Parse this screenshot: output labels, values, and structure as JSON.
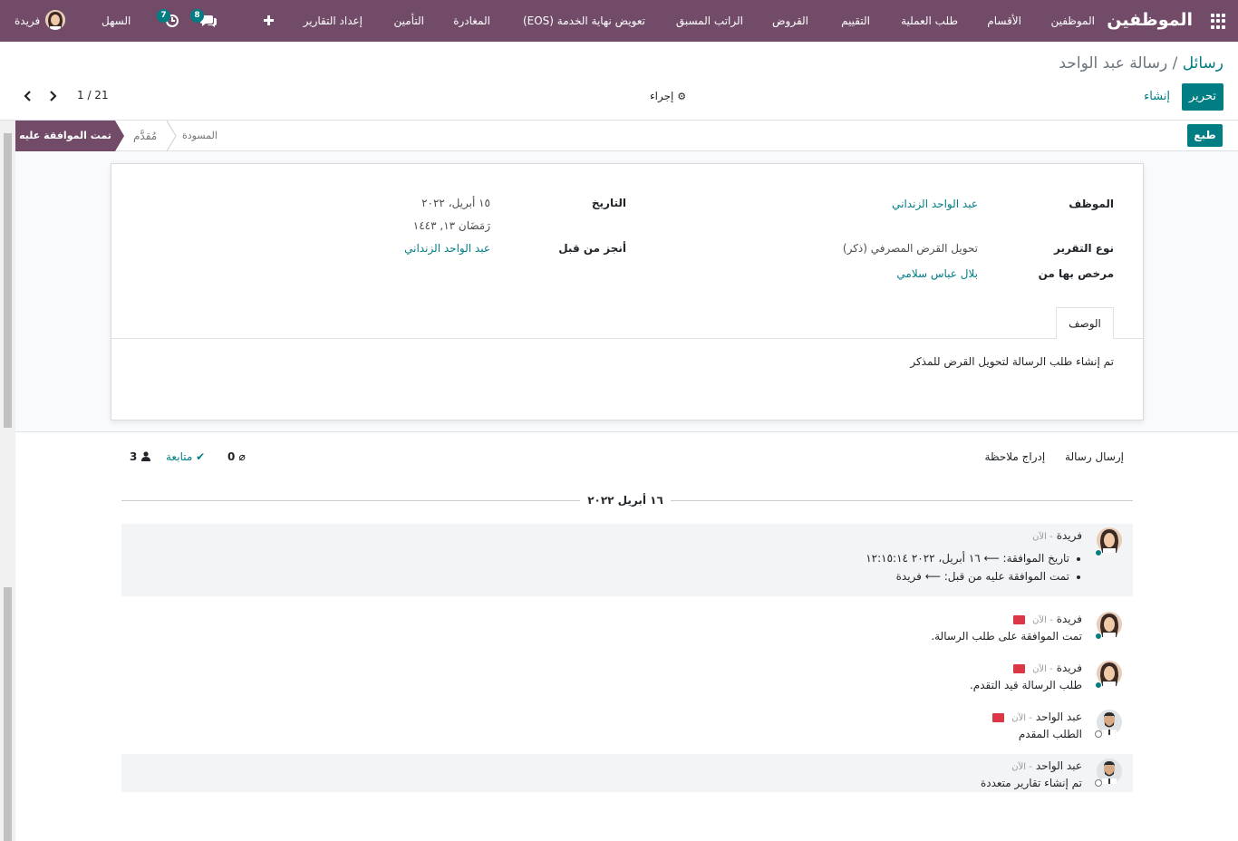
{
  "navbar": {
    "brand": "الموظفين",
    "menu": [
      "الموظفين",
      "الأقسام",
      "طلب العملية",
      "التقييم",
      "القروض",
      "الراتب المسبق",
      "تعويض نهاية الخدمة (EOS)",
      "المغادرة",
      "التأمين",
      "إعداد التقارير"
    ],
    "add_icon": "plus-icon",
    "messages_count": "8",
    "activities_count": "7",
    "company": "السهل",
    "user": "فريدة"
  },
  "control_panel": {
    "breadcrumb_parent": "رسائل",
    "breadcrumb_sep": " / ",
    "breadcrumb_current": "رسالة عبد الواحد",
    "edit_label": "تحرير",
    "create_label": "إنشاء",
    "action_label": "إجراء",
    "pager": "1 / 21"
  },
  "statusbar": {
    "print_label": "طبع",
    "stages": [
      "المسودة",
      "مُقدَّم",
      "تمت الموافقة عليه"
    ],
    "active_stage": "تمت الموافقة عليه"
  },
  "form": {
    "employee_label": "الموظف",
    "employee_value": "عبد الواحد الزنداني",
    "report_type_label": "نوع التقرير",
    "report_type_value": "تحويل القرض المصرفي (ذكر)",
    "approved_by_label": "مرخص بها من",
    "approved_by_value": "بلال عباس سلامي",
    "date_label": "التاريخ",
    "date_value": "١٥ أبريل، ٢٠٢٢",
    "hijri_value": "رَمَضَان ١٣, ١٤٤٣",
    "done_by_label": "أنجز من قبل",
    "done_by_value": "عبد الواحد الزنداني",
    "tab_label": "الوصف",
    "description": "تم إنشاء طلب الرسالة لتحويل القرض للمذكر"
  },
  "chatter": {
    "send_message": "إرسال رسالة",
    "log_note": "إدراج ملاحظة",
    "attachments_count": "0",
    "follow_label": "متابعة",
    "followers_count": "3",
    "date_separator": "١٦ أبريل ٢٠٢٢",
    "messages": [
      {
        "author": "فريدة",
        "time": "- الآن",
        "lines": [
          "تاريخ الموافقة: ⟵ ١٦ أبريل، ٢٠٢٢ ١٢:١٥:١٤",
          "تمت الموافقة عليه من قبل: ⟵ فريدة"
        ]
      },
      {
        "author": "فريدة",
        "time": "- الآن",
        "body": "تمت الموافقة على طلب الرسالة."
      },
      {
        "author": "فريدة",
        "time": "- الآن",
        "body": "طلب الرسالة قيد التقدم."
      },
      {
        "author": "عبد الواحد",
        "time": "- الآن",
        "body": "الطلب المقدم"
      },
      {
        "author": "عبد الواحد",
        "time": "- الآن",
        "body": "تم إنشاء تقارير متعددة"
      }
    ]
  },
  "colors": {
    "brand": "#714B67",
    "accent": "#017e84",
    "mail": "#dc3545"
  }
}
